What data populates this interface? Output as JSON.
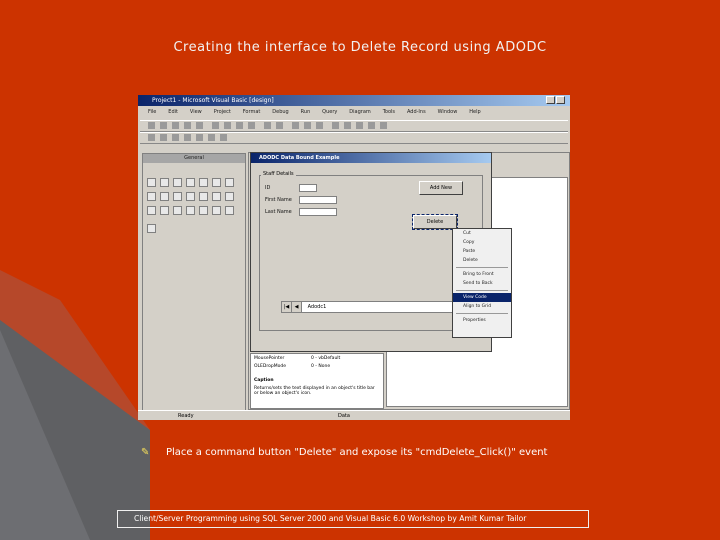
{
  "slide": {
    "title": "Creating the interface to Delete Record using ADODC",
    "instruction": "Place a command button \"Delete\" and expose its \"cmdDelete_Click()\" event",
    "footer": "Client/Server Programming using SQL Server 2000 and Visual Basic 6.0 Workshop by Amit Kumar Tailor",
    "bullet_icon": "bullet-cursor-icon"
  },
  "vb": {
    "title": "Project1 - Microsoft Visual Basic [design]",
    "menus": [
      "File",
      "Edit",
      "View",
      "Project",
      "Format",
      "Debug",
      "Run",
      "Query",
      "Diagram",
      "Tools",
      "Add-Ins",
      "Window",
      "Help"
    ],
    "toolbox_title": "General",
    "form_title": "ADODC Data Bound Example",
    "frame_label": "Staff Details",
    "labels": [
      "ID",
      "First Name",
      "Last Name"
    ],
    "add_button": "Add New",
    "delete_button": "Delete",
    "adodc_caption": "Adodc1",
    "context_menu": [
      "Cut",
      "Copy",
      "Paste",
      "Delete",
      "Bring to Front",
      "Send to Back",
      "View Code",
      "Align to Grid",
      "Properties"
    ],
    "props_rows": [
      "MousePointer",
      "OLEDropMode"
    ],
    "props_values": [
      "0 - vbDefault",
      "0 - None"
    ],
    "caption_title": "Caption",
    "caption_desc": "Returns/sets the text displayed in an object's title bar or below an object's icon.",
    "status_left": "Ready",
    "status_mid": "Data",
    "colors": {
      "slide_bg": "#cc3300",
      "grey_wedge": "#5f6063",
      "titlebar": "#0a246a"
    }
  }
}
